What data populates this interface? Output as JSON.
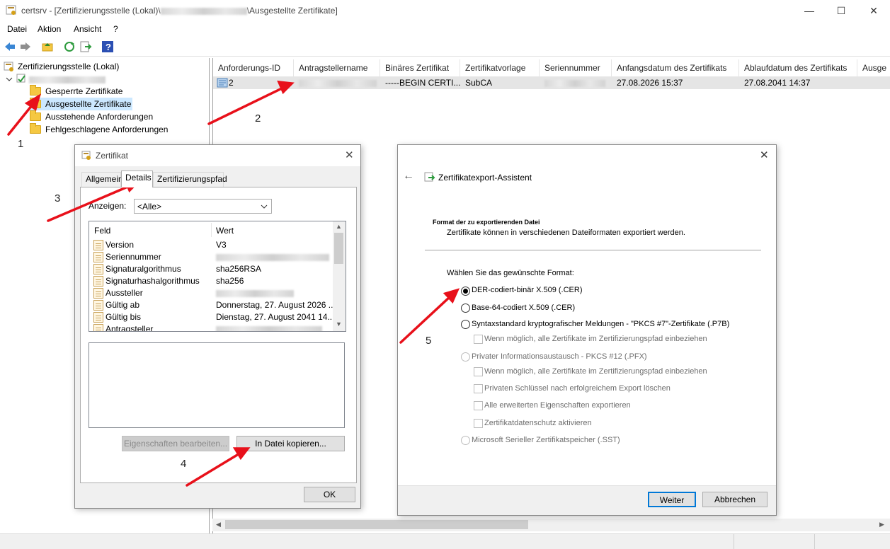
{
  "window": {
    "title": "certsrv - [Zertifizierungsstelle (Lokal)\\",
    "title_suffix": "\\Ausgestellte Zertifikate]",
    "minimize": "—",
    "maximize": "☐",
    "close": "✕"
  },
  "menu": [
    "Datei",
    "Aktion",
    "Ansicht",
    "?"
  ],
  "tree": {
    "root": "Zertifizierungsstelle (Lokal)",
    "items": [
      "Gesperrte Zertifikate",
      "Ausgestellte Zertifikate",
      "Ausstehende Anforderungen",
      "Fehlgeschlagene Anforderungen"
    ]
  },
  "list": {
    "columns": [
      "Anforderungs-ID",
      "Antragstellername",
      "Binäres Zertifikat",
      "Zertifikatvorlage",
      "Seriennummer",
      "Anfangsdatum des Zertifikats",
      "Ablaufdatum des Zertifikats",
      "Ausge"
    ],
    "row": {
      "id": "2",
      "binary": "-----BEGIN CERTI...",
      "template": "SubCA",
      "start": "27.08.2026 15:37",
      "end": "27.08.2041 14:37"
    }
  },
  "cert_dialog": {
    "title": "Zertifikat",
    "close": "✕",
    "tabs": [
      "Allgemein",
      "Details",
      "Zertifizierungspfad"
    ],
    "show_label": "Anzeigen:",
    "show_value": "<Alle>",
    "col_field": "Feld",
    "col_value": "Wert",
    "fields": [
      {
        "name": "Version",
        "value": "V3"
      },
      {
        "name": "Seriennummer",
        "value": ""
      },
      {
        "name": "Signaturalgorithmus",
        "value": "sha256RSA"
      },
      {
        "name": "Signaturhashalgorithmus",
        "value": "sha256"
      },
      {
        "name": "Aussteller",
        "value": ""
      },
      {
        "name": "Gültig ab",
        "value": "Donnerstag, 27. August 2026 ..."
      },
      {
        "name": "Gültig bis",
        "value": "Dienstag, 27. August 2041 14..."
      },
      {
        "name": "Antragsteller",
        "value": ""
      }
    ],
    "btn_edit": "Eigenschaften bearbeiten...",
    "btn_copy": "In Datei kopieren...",
    "btn_ok": "OK"
  },
  "wizard": {
    "title": "Zertifikatexport-Assistent",
    "close": "✕",
    "back": "←",
    "heading": "Format der zu exportierenden Datei",
    "subheading": "Zertifikate können in verschiedenen Dateiformaten exportiert werden.",
    "prompt": "Wählen Sie das gewünschte Format:",
    "opt_der": "DER-codiert-binär X.509 (.CER)",
    "opt_b64": "Base-64-codiert X.509 (.CER)",
    "opt_p7b": "Syntaxstandard kryptografischer Meldungen - \"PKCS #7\"-Zertifikate (.P7B)",
    "chk_p7b_chain": "Wenn möglich, alle Zertifikate im Zertifizierungspfad einbeziehen",
    "opt_pfx": "Privater Informationsaustausch - PKCS #12 (.PFX)",
    "chk_pfx_chain": "Wenn möglich, alle Zertifikate im Zertifizierungspfad einbeziehen",
    "chk_delete_key": "Privaten Schlüssel nach erfolgreichem Export löschen",
    "chk_ext_props": "Alle erweiterten Eigenschaften exportieren",
    "chk_privacy": "Zertifikatdatenschutz aktivieren",
    "opt_sst": "Microsoft Serieller Zertifikatspeicher (.SST)",
    "btn_next": "Weiter",
    "btn_cancel": "Abbrechen"
  },
  "annotations": [
    "1",
    "2",
    "3",
    "4",
    "5"
  ],
  "colors": {
    "arrow": "#e8101a",
    "selection": "#cce8ff"
  }
}
